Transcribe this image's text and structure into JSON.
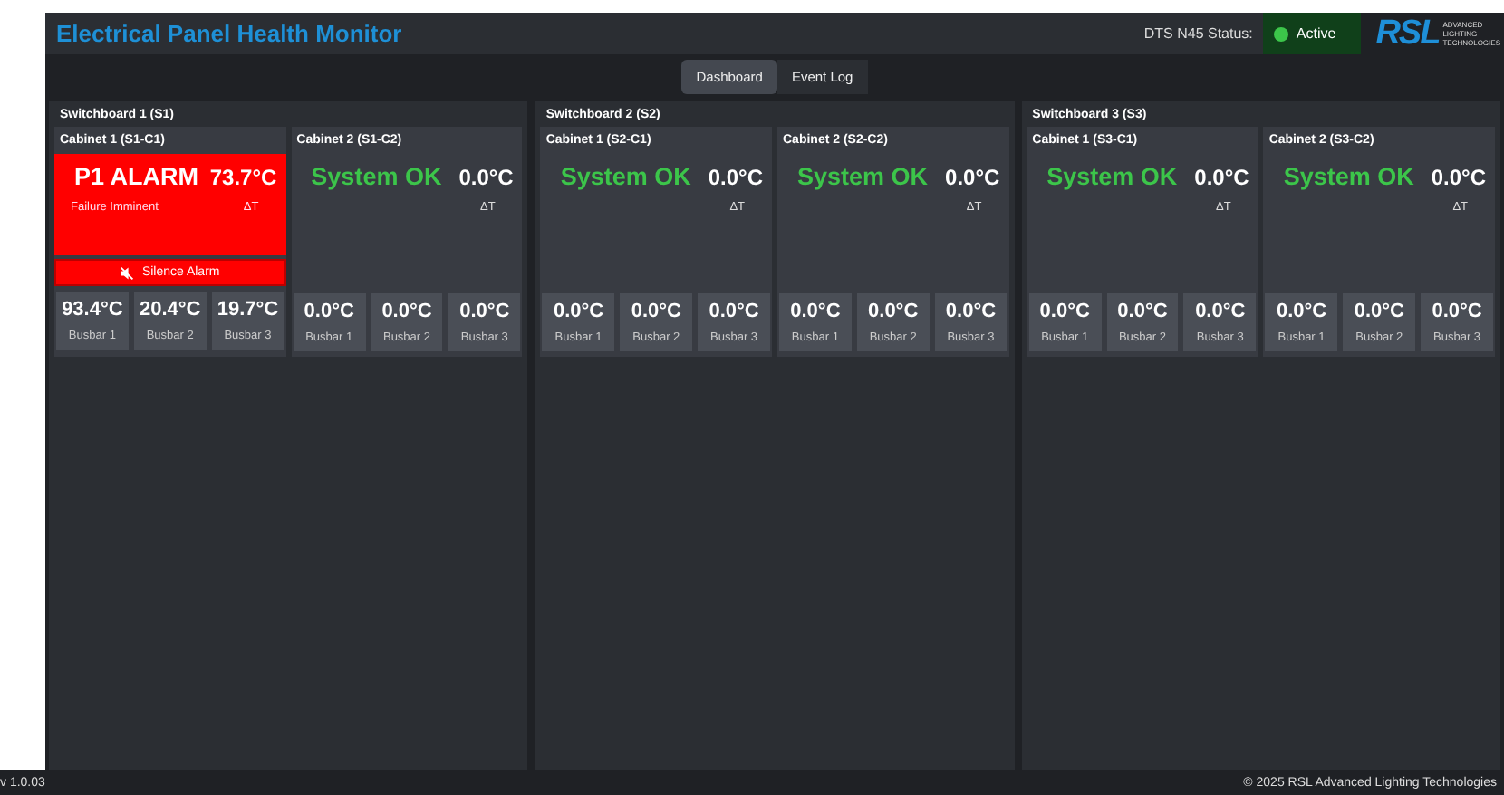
{
  "header": {
    "title": "Electrical Panel Health Monitor",
    "status_label": "DTS N45 Status:",
    "status": {
      "text": "Active",
      "on": true
    },
    "logo": {
      "mark": "RSL",
      "lines": [
        "ADVANCED",
        "LIGHTING",
        "TECHNOLOGIES"
      ]
    }
  },
  "tabs": [
    {
      "label": "Dashboard",
      "selected": true
    },
    {
      "label": "Event Log",
      "selected": false
    }
  ],
  "switchboards": [
    {
      "title": "Switchboard 1 (S1)",
      "cabinets": [
        {
          "title": "Cabinet 1 (S1-C1)",
          "kind": "alarm",
          "status": "P1 ALARM",
          "temp": "73.7°C",
          "message": "Failure Imminent",
          "delta": "ΔT",
          "action": "Silence Alarm",
          "busbars": [
            {
              "value": "93.4°C",
              "label": "Busbar 1"
            },
            {
              "value": "20.4°C",
              "label": "Busbar 2"
            },
            {
              "value": "19.7°C",
              "label": "Busbar 3"
            }
          ]
        },
        {
          "title": "Cabinet 2 (S1-C2)",
          "kind": "ok",
          "status": "System OK",
          "temp": "0.0°C",
          "delta": "ΔT",
          "busbars": [
            {
              "value": "0.0°C",
              "label": "Busbar 1"
            },
            {
              "value": "0.0°C",
              "label": "Busbar 2"
            },
            {
              "value": "0.0°C",
              "label": "Busbar 3"
            }
          ]
        }
      ]
    },
    {
      "title": "Switchboard 2 (S2)",
      "cabinets": [
        {
          "title": "Cabinet 1 (S2-C1)",
          "kind": "ok",
          "status": "System OK",
          "temp": "0.0°C",
          "delta": "ΔT",
          "busbars": [
            {
              "value": "0.0°C",
              "label": "Busbar 1"
            },
            {
              "value": "0.0°C",
              "label": "Busbar 2"
            },
            {
              "value": "0.0°C",
              "label": "Busbar 3"
            }
          ]
        },
        {
          "title": "Cabinet 2 (S2-C2)",
          "kind": "ok",
          "status": "System OK",
          "temp": "0.0°C",
          "delta": "ΔT",
          "busbars": [
            {
              "value": "0.0°C",
              "label": "Busbar 1"
            },
            {
              "value": "0.0°C",
              "label": "Busbar 2"
            },
            {
              "value": "0.0°C",
              "label": "Busbar 3"
            }
          ]
        }
      ]
    },
    {
      "title": "Switchboard 3 (S3)",
      "cabinets": [
        {
          "title": "Cabinet 1 (S3-C1)",
          "kind": "ok",
          "status": "System OK",
          "temp": "0.0°C",
          "delta": "ΔT",
          "busbars": [
            {
              "value": "0.0°C",
              "label": "Busbar 1"
            },
            {
              "value": "0.0°C",
              "label": "Busbar 2"
            },
            {
              "value": "0.0°C",
              "label": "Busbar 3"
            }
          ]
        },
        {
          "title": "Cabinet 2 (S3-C2)",
          "kind": "ok",
          "status": "System OK",
          "temp": "0.0°C",
          "delta": "ΔT",
          "busbars": [
            {
              "value": "0.0°C",
              "label": "Busbar 1"
            },
            {
              "value": "0.0°C",
              "label": "Busbar 2"
            },
            {
              "value": "0.0°C",
              "label": "Busbar 3"
            }
          ]
        }
      ]
    }
  ],
  "footer": {
    "version": "v 1.0.03",
    "copyright": "© 2025 RSL Advanced Lighting Technologies"
  }
}
